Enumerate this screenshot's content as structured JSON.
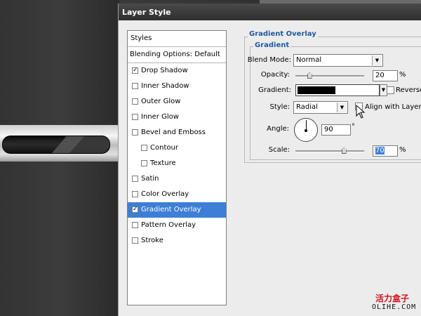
{
  "window": {
    "title": "Layer Style"
  },
  "styles_panel": {
    "header": "Styles",
    "blending_options": "Blending Options: Default",
    "items": [
      {
        "label": "Drop Shadow",
        "checked": true,
        "indent": false,
        "selected": false
      },
      {
        "label": "Inner Shadow",
        "checked": false,
        "indent": false,
        "selected": false
      },
      {
        "label": "Outer Glow",
        "checked": false,
        "indent": false,
        "selected": false
      },
      {
        "label": "Inner Glow",
        "checked": false,
        "indent": false,
        "selected": false
      },
      {
        "label": "Bevel and Emboss",
        "checked": false,
        "indent": false,
        "selected": false
      },
      {
        "label": "Contour",
        "checked": false,
        "indent": true,
        "selected": false
      },
      {
        "label": "Texture",
        "checked": false,
        "indent": true,
        "selected": false
      },
      {
        "label": "Satin",
        "checked": false,
        "indent": false,
        "selected": false
      },
      {
        "label": "Color Overlay",
        "checked": false,
        "indent": false,
        "selected": false
      },
      {
        "label": "Gradient Overlay",
        "checked": true,
        "indent": false,
        "selected": true
      },
      {
        "label": "Pattern Overlay",
        "checked": false,
        "indent": false,
        "selected": false
      },
      {
        "label": "Stroke",
        "checked": false,
        "indent": false,
        "selected": false
      }
    ]
  },
  "gradient_overlay": {
    "section_title": "Gradient Overlay",
    "subsection_title": "Gradient",
    "blend_mode": {
      "label": "Blend Mode:",
      "value": "Normal"
    },
    "opacity": {
      "label": "Opacity:",
      "value": "20",
      "unit": "%",
      "level": 0.2
    },
    "gradient": {
      "label": "Gradient:",
      "reverse_label": "Reverse",
      "reverse_checked": false
    },
    "style": {
      "label": "Style:",
      "value": "Radial",
      "align_label": "Align with Layer",
      "align_checked": false
    },
    "angle": {
      "label": "Angle:",
      "value": "90",
      "unit": "°"
    },
    "scale": {
      "label": "Scale:",
      "value": "70",
      "unit": "%",
      "level": 0.7
    }
  },
  "watermark": {
    "line1": "活力盒子",
    "line2": "OLIHE.COM"
  },
  "colors": {
    "selection": "#3d7fd6",
    "legend": "#1e5a9e",
    "title_bar": "#3a3a3a"
  }
}
